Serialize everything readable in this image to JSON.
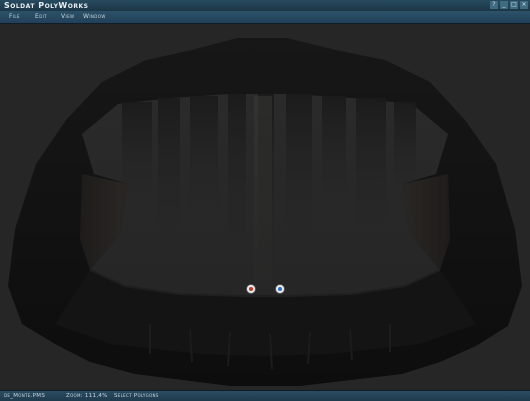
{
  "window": {
    "title": "Soldat PolyWorks",
    "buttons": [
      "?",
      "_",
      "□",
      "×"
    ]
  },
  "menu": {
    "items": [
      "File",
      "Edit",
      "View",
      "Window"
    ]
  },
  "status": {
    "filename": "de_Monte.PMS",
    "zoom": "Zoom: 111,4%",
    "mode": "Select Polygons"
  },
  "colors": {
    "titlebar": "#1c3646",
    "canvas_bg": "#262626",
    "polygon_dark": "#121212",
    "spawn_red": "#c0392b",
    "spawn_blue": "#2b6fc0"
  }
}
